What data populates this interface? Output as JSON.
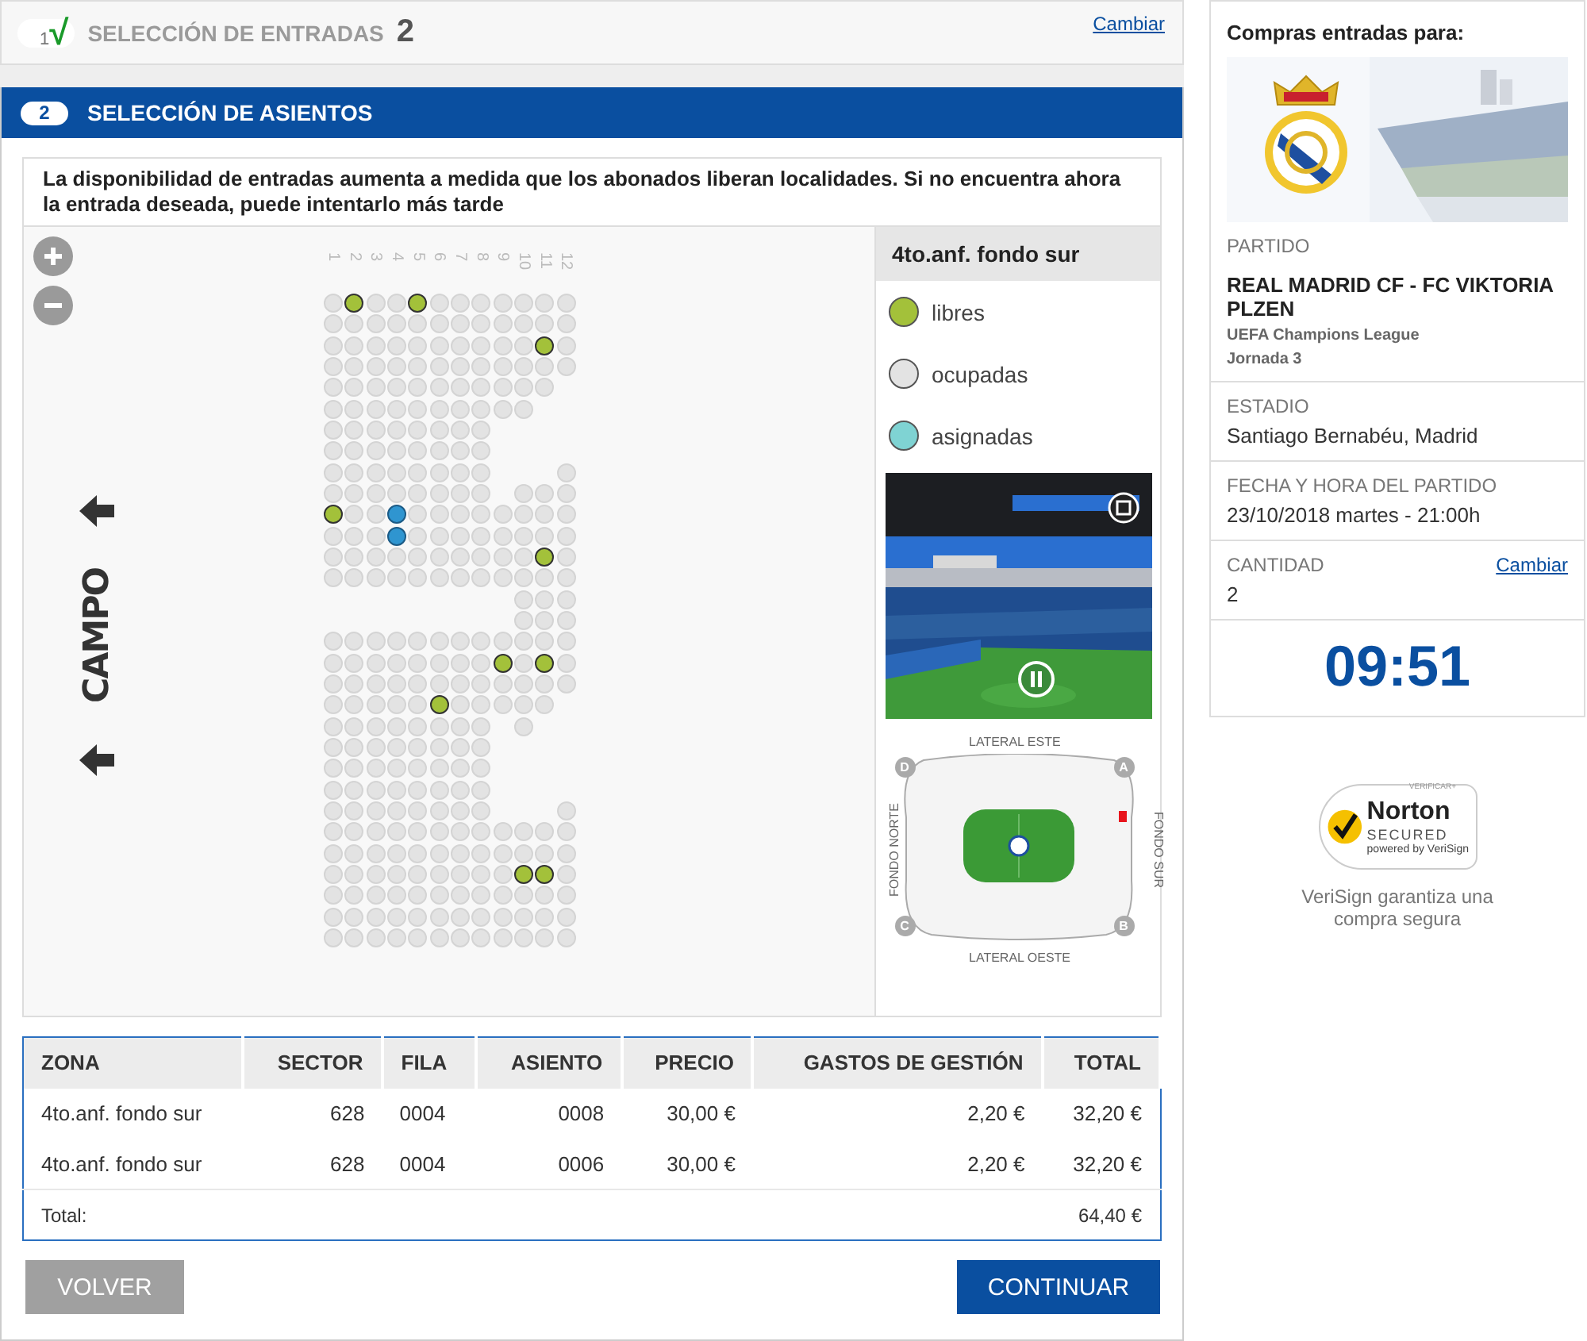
{
  "steps": [
    {
      "kind": "done",
      "number": "1",
      "check": "√",
      "title": "SELECCIÓN DE ENTRADAS",
      "value": "2",
      "link": "Cambiar"
    },
    {
      "kind": "active",
      "number": "2",
      "title": "SELECCIÓN DE ASIENTOS"
    }
  ],
  "notice": "La disponibilidad de entradas aumenta a medida que los abonados liberan localidades. Si no encuentra ahora la entrada deseada, puede intentarlo más tarde",
  "field_label": "CAMPO",
  "seat_map": {
    "columns": [
      "1",
      "2",
      "3",
      "4",
      "5",
      "6",
      "7",
      "8",
      "9",
      "10",
      "11",
      "12"
    ],
    "rows": [
      [
        {
          "kind": "taken"
        },
        {
          "kind": "free"
        },
        {
          "kind": "taken"
        },
        {
          "kind": "taken"
        },
        {
          "kind": "free"
        },
        {
          "kind": "taken"
        },
        {
          "kind": "taken"
        },
        {
          "kind": "taken"
        },
        {
          "kind": "taken"
        },
        {
          "kind": "taken"
        },
        {
          "kind": "taken"
        },
        {
          "kind": "taken"
        }
      ],
      [
        {
          "kind": "taken"
        },
        {
          "kind": "taken"
        },
        {
          "kind": "taken"
        },
        {
          "kind": "taken"
        },
        {
          "kind": "taken"
        },
        {
          "kind": "taken"
        },
        {
          "kind": "taken"
        },
        {
          "kind": "taken"
        },
        {
          "kind": "taken"
        },
        {
          "kind": "taken"
        },
        {
          "kind": "taken"
        },
        {
          "kind": "taken"
        }
      ],
      [
        {
          "kind": "taken"
        },
        {
          "kind": "taken"
        },
        {
          "kind": "taken"
        },
        {
          "kind": "taken"
        },
        {
          "kind": "taken"
        },
        {
          "kind": "taken"
        },
        {
          "kind": "taken"
        },
        {
          "kind": "taken"
        },
        {
          "kind": "taken"
        },
        {
          "kind": "taken"
        },
        {
          "kind": "free"
        },
        {
          "kind": "taken"
        }
      ],
      [
        {
          "kind": "taken"
        },
        {
          "kind": "taken"
        },
        {
          "kind": "taken"
        },
        {
          "kind": "taken"
        },
        {
          "kind": "taken"
        },
        {
          "kind": "taken"
        },
        {
          "kind": "taken"
        },
        {
          "kind": "taken"
        },
        {
          "kind": "taken"
        },
        {
          "kind": "taken"
        },
        {
          "kind": "taken"
        },
        {
          "kind": "taken"
        }
      ],
      [
        {
          "kind": "taken"
        },
        {
          "kind": "taken"
        },
        {
          "kind": "taken"
        },
        {
          "kind": "taken"
        },
        {
          "kind": "taken"
        },
        {
          "kind": "taken"
        },
        {
          "kind": "taken"
        },
        {
          "kind": "taken"
        },
        {
          "kind": "taken"
        },
        {
          "kind": "taken"
        },
        {
          "kind": "taken"
        },
        null
      ],
      [
        {
          "kind": "taken"
        },
        {
          "kind": "taken"
        },
        {
          "kind": "taken"
        },
        {
          "kind": "taken"
        },
        {
          "kind": "taken"
        },
        {
          "kind": "taken"
        },
        {
          "kind": "taken"
        },
        {
          "kind": "taken"
        },
        {
          "kind": "taken"
        },
        {
          "kind": "taken"
        },
        null,
        null
      ],
      [
        {
          "kind": "taken"
        },
        {
          "kind": "taken"
        },
        {
          "kind": "taken"
        },
        {
          "kind": "taken"
        },
        {
          "kind": "taken"
        },
        {
          "kind": "taken"
        },
        {
          "kind": "taken"
        },
        {
          "kind": "taken"
        },
        null,
        null,
        null,
        null
      ],
      [
        {
          "kind": "taken"
        },
        {
          "kind": "taken"
        },
        {
          "kind": "taken"
        },
        {
          "kind": "taken"
        },
        {
          "kind": "taken"
        },
        {
          "kind": "taken"
        },
        {
          "kind": "taken"
        },
        {
          "kind": "taken"
        },
        null,
        null,
        null,
        null
      ],
      [
        {
          "kind": "taken"
        },
        {
          "kind": "taken"
        },
        {
          "kind": "taken"
        },
        {
          "kind": "taken"
        },
        {
          "kind": "taken"
        },
        {
          "kind": "taken"
        },
        {
          "kind": "taken"
        },
        {
          "kind": "taken"
        },
        null,
        null,
        null,
        {
          "kind": "taken"
        }
      ],
      [
        {
          "kind": "taken"
        },
        {
          "kind": "taken"
        },
        {
          "kind": "taken"
        },
        {
          "kind": "taken"
        },
        {
          "kind": "taken"
        },
        {
          "kind": "taken"
        },
        {
          "kind": "taken"
        },
        {
          "kind": "taken"
        },
        null,
        {
          "kind": "taken"
        },
        {
          "kind": "taken"
        },
        {
          "kind": "taken"
        }
      ],
      [
        {
          "kind": "free"
        },
        {
          "kind": "taken"
        },
        {
          "kind": "taken"
        },
        {
          "kind": "assigned"
        },
        {
          "kind": "taken"
        },
        {
          "kind": "taken"
        },
        {
          "kind": "taken"
        },
        {
          "kind": "taken"
        },
        {
          "kind": "taken"
        },
        {
          "kind": "taken"
        },
        {
          "kind": "taken"
        },
        {
          "kind": "taken"
        }
      ],
      [
        {
          "kind": "taken"
        },
        {
          "kind": "taken"
        },
        {
          "kind": "taken"
        },
        {
          "kind": "assigned"
        },
        {
          "kind": "taken"
        },
        {
          "kind": "taken"
        },
        {
          "kind": "taken"
        },
        {
          "kind": "taken"
        },
        {
          "kind": "taken"
        },
        {
          "kind": "taken"
        },
        {
          "kind": "taken"
        },
        {
          "kind": "taken"
        }
      ],
      [
        {
          "kind": "taken"
        },
        {
          "kind": "taken"
        },
        {
          "kind": "taken"
        },
        {
          "kind": "taken"
        },
        {
          "kind": "taken"
        },
        {
          "kind": "taken"
        },
        {
          "kind": "taken"
        },
        {
          "kind": "taken"
        },
        {
          "kind": "taken"
        },
        {
          "kind": "taken"
        },
        {
          "kind": "free"
        },
        {
          "kind": "taken"
        }
      ],
      [
        {
          "kind": "taken"
        },
        {
          "kind": "taken"
        },
        {
          "kind": "taken"
        },
        {
          "kind": "taken"
        },
        {
          "kind": "taken"
        },
        {
          "kind": "taken"
        },
        {
          "kind": "taken"
        },
        {
          "kind": "taken"
        },
        {
          "kind": "taken"
        },
        {
          "kind": "taken"
        },
        {
          "kind": "taken"
        },
        {
          "kind": "taken"
        }
      ],
      [
        null,
        null,
        null,
        null,
        null,
        null,
        null,
        null,
        null,
        {
          "kind": "taken"
        },
        {
          "kind": "taken"
        },
        {
          "kind": "taken"
        }
      ],
      [
        null,
        null,
        null,
        null,
        null,
        null,
        null,
        null,
        null,
        {
          "kind": "taken"
        },
        {
          "kind": "taken"
        },
        {
          "kind": "taken"
        }
      ],
      [
        {
          "kind": "taken"
        },
        {
          "kind": "taken"
        },
        {
          "kind": "taken"
        },
        {
          "kind": "taken"
        },
        {
          "kind": "taken"
        },
        {
          "kind": "taken"
        },
        {
          "kind": "taken"
        },
        {
          "kind": "taken"
        },
        {
          "kind": "taken"
        },
        {
          "kind": "taken"
        },
        {
          "kind": "taken"
        },
        {
          "kind": "taken"
        }
      ],
      [
        {
          "kind": "taken"
        },
        {
          "kind": "taken"
        },
        {
          "kind": "taken"
        },
        {
          "kind": "taken"
        },
        {
          "kind": "taken"
        },
        {
          "kind": "taken"
        },
        {
          "kind": "taken"
        },
        {
          "kind": "taken"
        },
        {
          "kind": "free"
        },
        {
          "kind": "taken"
        },
        {
          "kind": "free"
        },
        {
          "kind": "taken"
        }
      ],
      [
        {
          "kind": "taken"
        },
        {
          "kind": "taken"
        },
        {
          "kind": "taken"
        },
        {
          "kind": "taken"
        },
        {
          "kind": "taken"
        },
        {
          "kind": "taken"
        },
        {
          "kind": "taken"
        },
        {
          "kind": "taken"
        },
        {
          "kind": "taken"
        },
        {
          "kind": "taken"
        },
        {
          "kind": "taken"
        },
        {
          "kind": "taken"
        }
      ],
      [
        {
          "kind": "taken"
        },
        {
          "kind": "taken"
        },
        {
          "kind": "taken"
        },
        {
          "kind": "taken"
        },
        {
          "kind": "taken"
        },
        {
          "kind": "free"
        },
        {
          "kind": "taken"
        },
        {
          "kind": "taken"
        },
        {
          "kind": "taken"
        },
        {
          "kind": "taken"
        },
        {
          "kind": "taken"
        },
        null
      ],
      [
        {
          "kind": "taken"
        },
        {
          "kind": "taken"
        },
        {
          "kind": "taken"
        },
        {
          "kind": "taken"
        },
        {
          "kind": "taken"
        },
        {
          "kind": "taken"
        },
        {
          "kind": "taken"
        },
        {
          "kind": "taken"
        },
        null,
        {
          "kind": "taken"
        },
        null,
        null
      ],
      [
        {
          "kind": "taken"
        },
        {
          "kind": "taken"
        },
        {
          "kind": "taken"
        },
        {
          "kind": "taken"
        },
        {
          "kind": "taken"
        },
        {
          "kind": "taken"
        },
        {
          "kind": "taken"
        },
        {
          "kind": "taken"
        },
        null,
        null,
        null,
        null
      ],
      [
        {
          "kind": "taken"
        },
        {
          "kind": "taken"
        },
        {
          "kind": "taken"
        },
        {
          "kind": "taken"
        },
        {
          "kind": "taken"
        },
        {
          "kind": "taken"
        },
        {
          "kind": "taken"
        },
        {
          "kind": "taken"
        },
        null,
        null,
        null,
        null
      ],
      [
        {
          "kind": "taken"
        },
        {
          "kind": "taken"
        },
        {
          "kind": "taken"
        },
        {
          "kind": "taken"
        },
        {
          "kind": "taken"
        },
        {
          "kind": "taken"
        },
        {
          "kind": "taken"
        },
        {
          "kind": "taken"
        },
        null,
        null,
        null,
        null
      ],
      [
        {
          "kind": "taken"
        },
        {
          "kind": "taken"
        },
        {
          "kind": "taken"
        },
        {
          "kind": "taken"
        },
        {
          "kind": "taken"
        },
        {
          "kind": "taken"
        },
        {
          "kind": "taken"
        },
        {
          "kind": "taken"
        },
        null,
        null,
        null,
        {
          "kind": "taken"
        }
      ],
      [
        {
          "kind": "taken"
        },
        {
          "kind": "taken"
        },
        {
          "kind": "taken"
        },
        {
          "kind": "taken"
        },
        {
          "kind": "taken"
        },
        {
          "kind": "taken"
        },
        {
          "kind": "taken"
        },
        {
          "kind": "taken"
        },
        {
          "kind": "taken"
        },
        {
          "kind": "taken"
        },
        {
          "kind": "taken"
        },
        {
          "kind": "taken"
        }
      ],
      [
        {
          "kind": "taken"
        },
        {
          "kind": "taken"
        },
        {
          "kind": "taken"
        },
        {
          "kind": "taken"
        },
        {
          "kind": "taken"
        },
        {
          "kind": "taken"
        },
        {
          "kind": "taken"
        },
        {
          "kind": "taken"
        },
        {
          "kind": "taken"
        },
        {
          "kind": "taken"
        },
        {
          "kind": "taken"
        },
        {
          "kind": "taken"
        }
      ],
      [
        {
          "kind": "taken"
        },
        {
          "kind": "taken"
        },
        {
          "kind": "taken"
        },
        {
          "kind": "taken"
        },
        {
          "kind": "taken"
        },
        {
          "kind": "taken"
        },
        {
          "kind": "taken"
        },
        {
          "kind": "taken"
        },
        {
          "kind": "taken"
        },
        {
          "kind": "free"
        },
        {
          "kind": "free"
        },
        {
          "kind": "taken"
        }
      ],
      [
        {
          "kind": "taken"
        },
        {
          "kind": "taken"
        },
        {
          "kind": "taken"
        },
        {
          "kind": "taken"
        },
        {
          "kind": "taken"
        },
        {
          "kind": "taken"
        },
        {
          "kind": "taken"
        },
        {
          "kind": "taken"
        },
        {
          "kind": "taken"
        },
        {
          "kind": "taken"
        },
        {
          "kind": "taken"
        },
        {
          "kind": "taken"
        }
      ],
      [
        {
          "kind": "taken"
        },
        {
          "kind": "taken"
        },
        {
          "kind": "taken"
        },
        {
          "kind": "taken"
        },
        {
          "kind": "taken"
        },
        {
          "kind": "taken"
        },
        {
          "kind": "taken"
        },
        {
          "kind": "taken"
        },
        {
          "kind": "taken"
        },
        {
          "kind": "taken"
        },
        {
          "kind": "taken"
        },
        {
          "kind": "taken"
        }
      ],
      [
        {
          "kind": "taken"
        },
        {
          "kind": "taken"
        },
        {
          "kind": "taken"
        },
        {
          "kind": "taken"
        },
        {
          "kind": "taken"
        },
        {
          "kind": "taken"
        },
        {
          "kind": "taken"
        },
        {
          "kind": "taken"
        },
        {
          "kind": "taken"
        },
        {
          "kind": "taken"
        },
        {
          "kind": "taken"
        },
        {
          "kind": "taken"
        }
      ]
    ]
  },
  "sector_panel": {
    "title": "4to.anf. fondo sur",
    "legend": [
      {
        "label": "libres",
        "color": "#a3c13a"
      },
      {
        "label": "ocupadas",
        "color": "#e3e3e3"
      },
      {
        "label": "asignadas",
        "color": "#7fd3d3"
      }
    ]
  },
  "stadium_map": {
    "top": "LATERAL ESTE",
    "bottom": "LATERAL OESTE",
    "left": "FONDO NORTE",
    "right": "FONDO SUR",
    "corners": [
      "D",
      "A",
      "C",
      "B"
    ]
  },
  "table": {
    "columns": [
      "ZONA",
      "SECTOR",
      "FILA",
      "ASIENTO",
      "PRECIO",
      "GASTOS DE GESTIÓN",
      "TOTAL"
    ],
    "rows": [
      [
        "4to.anf. fondo sur",
        "628",
        "0004",
        "0008",
        "30,00 €",
        "2,20 €",
        "32,20 €"
      ],
      [
        "4to.anf. fondo sur",
        "628",
        "0004",
        "0006",
        "30,00 €",
        "2,20 €",
        "32,20 €"
      ]
    ],
    "total_label": "Total:",
    "total": "64,40 €"
  },
  "buttons": {
    "back": "VOLVER",
    "next": "CONTINUAR"
  },
  "sidebar": {
    "heading": "Compras entradas para:",
    "match_label": "PARTIDO",
    "match": "REAL MADRID CF - FC VIKTORIA PLZEN",
    "competition": "UEFA Champions League",
    "round": "Jornada 3",
    "details": [
      {
        "label": "ESTADIO",
        "value": "Santiago Bernabéu, Madrid"
      },
      {
        "label": "FECHA Y HORA DEL PARTIDO",
        "value": "23/10/2018 martes - 21:00h"
      },
      {
        "label": "CANTIDAD",
        "value": "2",
        "link": "Cambiar"
      }
    ],
    "timer": "09:51"
  },
  "security": {
    "verify": "VERIFICAR+",
    "brand": "Norton",
    "secured": "SECURED",
    "powered": "powered by VeriSign",
    "caption": "VeriSign garantiza una compra segura"
  }
}
